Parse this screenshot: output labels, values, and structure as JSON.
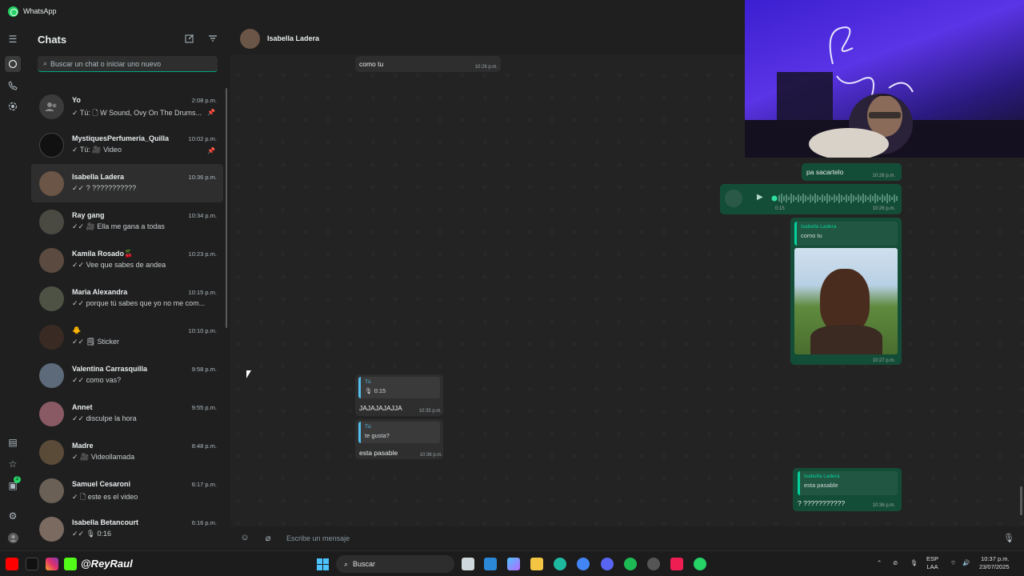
{
  "titlebar": {
    "app_name": "WhatsApp"
  },
  "rail": {
    "updates_badge": "2"
  },
  "sidebar": {
    "title": "Chats",
    "search_placeholder": "Buscar un chat o iniciar uno nuevo",
    "chats": [
      {
        "name": "Yo",
        "time": "2:08 p.m.",
        "preview": "✓ Tú: 🗋 W Sound, Ovy On The Drums...",
        "pinned": true,
        "avatar_color": "#3b3b3b"
      },
      {
        "name": "MystiquesPerfumeria_Quilla",
        "time": "10:02 p.m.",
        "preview": "✓ Tú: 🎥 Video",
        "pinned": true,
        "avatar_color": "#111111"
      },
      {
        "name": "Isabella  Ladera",
        "time": "10:36 p.m.",
        "preview": "✓✓ ? ???????????",
        "pinned": false,
        "avatar_color": "#6b5546"
      },
      {
        "name": "Ray gang",
        "time": "10:34 p.m.",
        "preview": "✓✓ 🎥 Ella me gana a todas",
        "pinned": false,
        "avatar_color": "#4a4a42"
      },
      {
        "name": "Kamila Rosado🍒",
        "time": "10:23 p.m.",
        "preview": "✓✓ Vee que sabes de andea",
        "pinned": false,
        "avatar_color": "#5a4a40"
      },
      {
        "name": "Maria Alexandra",
        "time": "10:15 p.m.",
        "preview": "✓✓ porque tú sabes que yo no me com...",
        "pinned": false,
        "avatar_color": "#4e5244"
      },
      {
        "name": "🐥",
        "time": "10:10 p.m.",
        "preview": "✓✓ 🗒 Sticker",
        "pinned": false,
        "avatar_color": "#3a2a24"
      },
      {
        "name": "Valentina Carrasquilla",
        "time": "9:58 p.m.",
        "preview": "✓✓ como vas?",
        "pinned": false,
        "avatar_color": "#5d6a7a"
      },
      {
        "name": "Annet",
        "time": "9:55 p.m.",
        "preview": "✓✓ disculpe la hora",
        "pinned": false,
        "avatar_color": "#8a5a64"
      },
      {
        "name": "Madre",
        "time": "8:48 p.m.",
        "preview": "✓ 🎥 Videollamada",
        "pinned": false,
        "avatar_color": "#5a4a38"
      },
      {
        "name": "Samuel Cesaroni",
        "time": "6:17 p.m.",
        "preview": "✓ 🗋 este es el video",
        "pinned": false,
        "avatar_color": "#6a6056"
      },
      {
        "name": "Isabella Betancourt",
        "time": "6:16 p.m.",
        "preview": "✓✓ 🎙 0:16",
        "pinned": false,
        "avatar_color": "#7a6a60"
      }
    ]
  },
  "chat": {
    "contact_name": "Isabella  Ladera",
    "messages": {
      "m1": {
        "text": "como tu",
        "time": "10:26 p.m."
      },
      "m2": {
        "text": "pa sacartelo",
        "time": "10:26 p.m."
      },
      "m3": {
        "duration": "0:15",
        "time": "10:26 p.m."
      },
      "m4": {
        "quote_author": "Isabella  Ladera",
        "quote_text": "como tu",
        "time": "10:27 p.m."
      },
      "m5": {
        "quote_author": "Tú",
        "quote_text": "🎙 0:15",
        "text": "JAJAJAJAJJA",
        "time": "10:35 p.m."
      },
      "m6": {
        "quote_author": "Tú",
        "quote_text": "te gusta?",
        "text": "esta pasable",
        "time": "10:36 p.m."
      },
      "m7": {
        "quote_author": "Isabella  Ladera",
        "quote_text": "esta pasable",
        "text": "? ???????????",
        "time": "10:36 p.m."
      }
    },
    "compose_placeholder": "Escribe un mensaje"
  },
  "taskbar": {
    "handle": "@ReyRaul",
    "search_label": "Buscar",
    "lang_line1": "ESP",
    "lang_line2": "LAA",
    "clock_time": "10:37 p.m.",
    "clock_date": "23/07/2025"
  },
  "colors": {
    "accent": "#00a884",
    "outgoing_bubble": "#144d37",
    "incoming_bubble": "#2e2e2e"
  }
}
